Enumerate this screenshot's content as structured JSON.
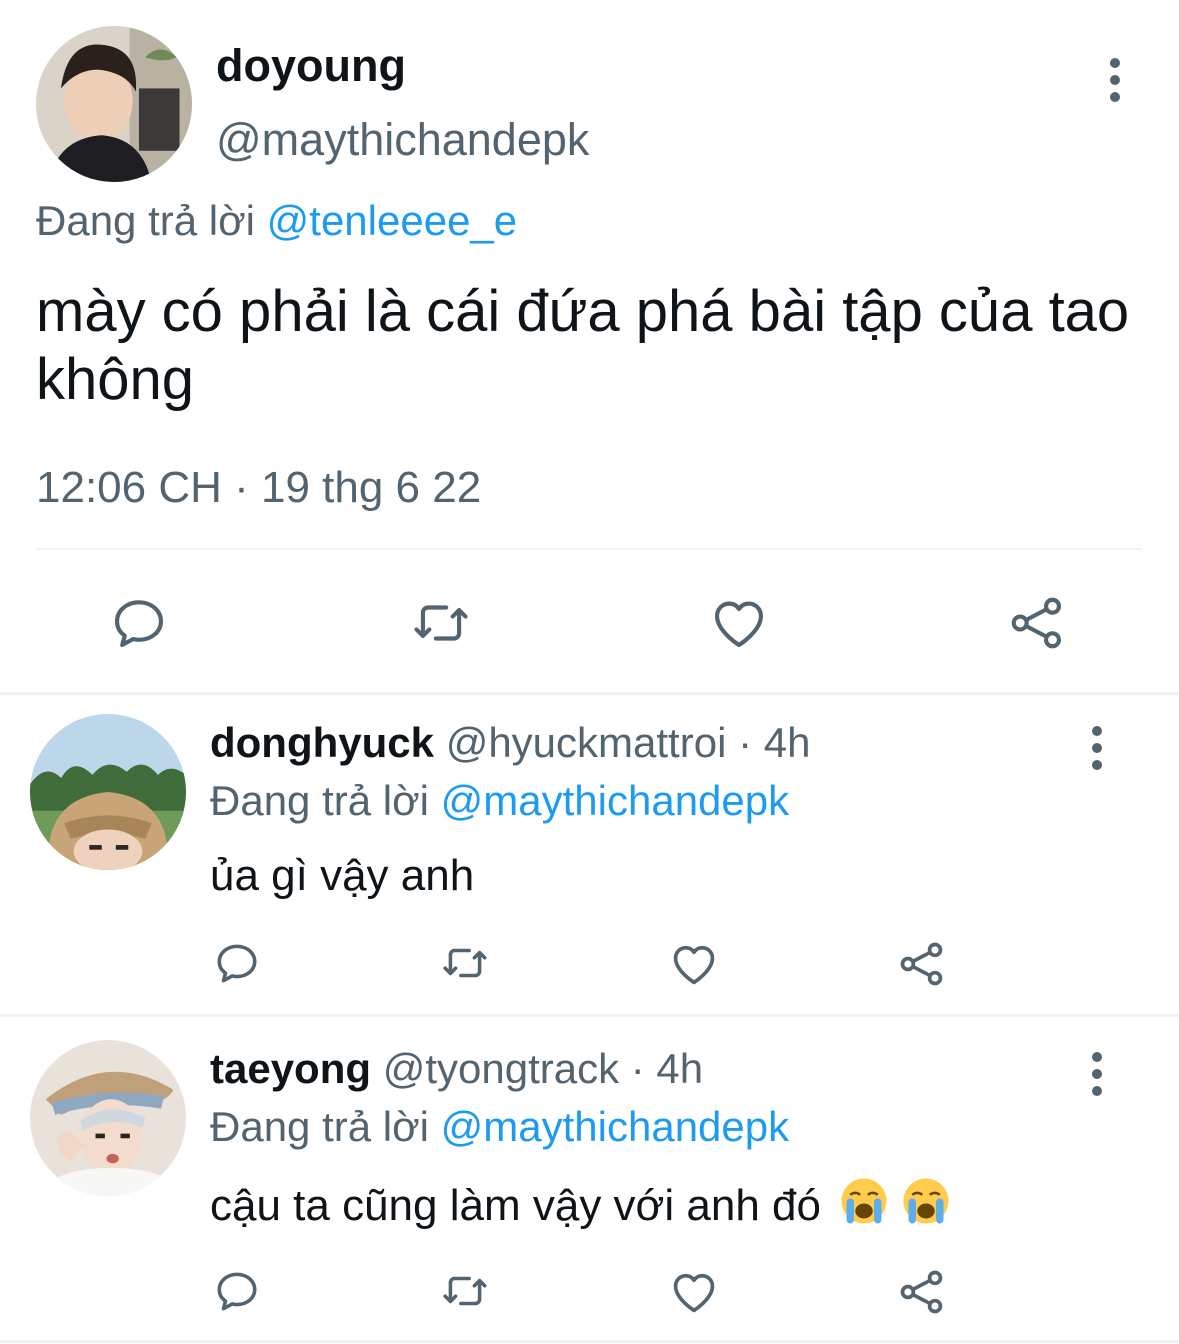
{
  "main_tweet": {
    "display_name": "doyoung",
    "handle": "@maythichandepk",
    "replying_prefix": "Đang trả lời",
    "replying_to": "@tenleeee_e",
    "text": "mày có phải là cái đứa phá bài tập của tao không",
    "timestamp": "12:06 CH · 19 thg 6 22"
  },
  "replies": [
    {
      "display_name": "donghyuck",
      "handle": "@hyuckmattroi",
      "time": "· 4h",
      "replying_prefix": "Đang trả lời",
      "replying_to": "@maythichandepk",
      "text": "ủa gì vậy anh"
    },
    {
      "display_name": "taeyong",
      "handle": "@tyongtrack",
      "time": "· 4h",
      "replying_prefix": "Đang trả lời",
      "replying_to": "@maythichandepk",
      "text": "cậu ta cũng làm vậy với anh đó",
      "emojis": [
        "loudly-crying-face",
        "loudly-crying-face"
      ]
    }
  ],
  "icons": {
    "reply": "comment-bubble-icon",
    "retweet": "retweet-icon",
    "like": "heart-icon",
    "share": "share-icon",
    "more": "more-vertical-icon"
  },
  "colors": {
    "link": "#1d9bf0",
    "muted": "#536471",
    "text": "#0f1419",
    "divider": "#eff3f4"
  }
}
